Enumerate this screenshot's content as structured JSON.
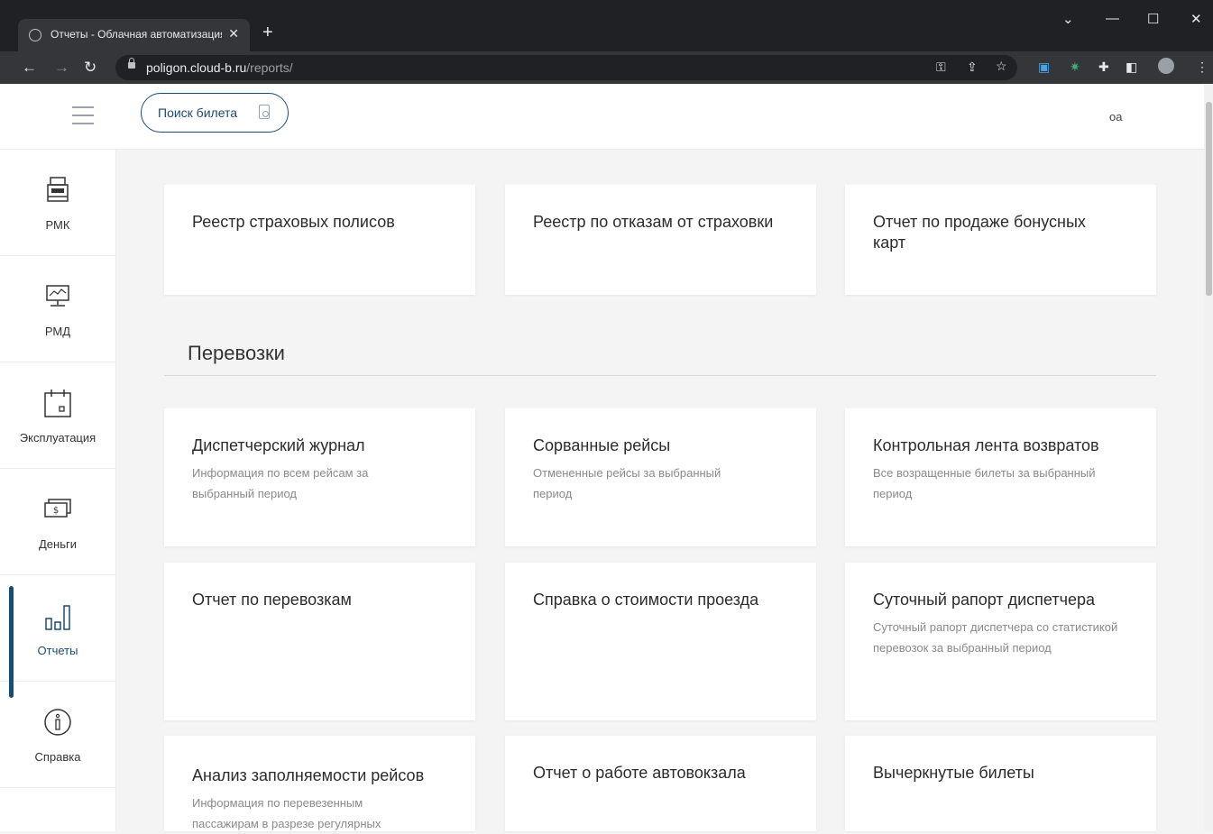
{
  "browser": {
    "tab_title": "Отчеты - Облачная автоматизация",
    "tab_close": "✕",
    "new_tab": "+",
    "url_host": "poligon.cloud-b.ru",
    "url_path": "/reports/",
    "window_controls": [
      "⌄",
      "—",
      "☐",
      "✕"
    ]
  },
  "header": {
    "search_label": "Поиск билета",
    "user": "оа"
  },
  "sidebar": {
    "items": [
      {
        "label": "РМК",
        "icon": "cash-register-icon"
      },
      {
        "label": "РМД",
        "icon": "monitor-icon"
      },
      {
        "label": "Эксплуатация",
        "icon": "calendar-icon"
      },
      {
        "label": "Деньги",
        "icon": "money-icon"
      },
      {
        "label": "Отчеты",
        "icon": "bar-chart-icon",
        "active": true
      },
      {
        "label": "Справка",
        "icon": "info-icon"
      }
    ]
  },
  "main": {
    "top_cards": [
      {
        "title": "Реестр страховых полисов"
      },
      {
        "title": "Реестр по отказам от страховки"
      },
      {
        "title": "Отчет по продаже бонусных карт"
      }
    ],
    "section_title": "Перевозки",
    "transport_cards": [
      {
        "title": "Диспетчерский журнал",
        "desc": "Информация по всем рейсам за выбранный период"
      },
      {
        "title": "Сорванные рейсы",
        "desc": "Отмененные рейсы за выбранный период"
      },
      {
        "title": "Контрольная лента возвратов",
        "desc": "Все возращенные билеты за выбранный период"
      },
      {
        "title": "Отчет по перевозкам",
        "desc": ""
      },
      {
        "title": "Справка о стоимости проезда",
        "desc": ""
      },
      {
        "title": "Суточный рапорт диспетчера",
        "desc": "Суточный рапорт диспетчера со статистикой перевозок за выбранный период"
      },
      {
        "title": "Анализ заполняемости рейсов",
        "desc": "Информация по перевезенным пассажирам в разрезе регулярных"
      },
      {
        "title": "Отчет о работе автовокзала",
        "desc": ""
      },
      {
        "title": "Вычеркнутые билеты",
        "desc": ""
      }
    ]
  }
}
